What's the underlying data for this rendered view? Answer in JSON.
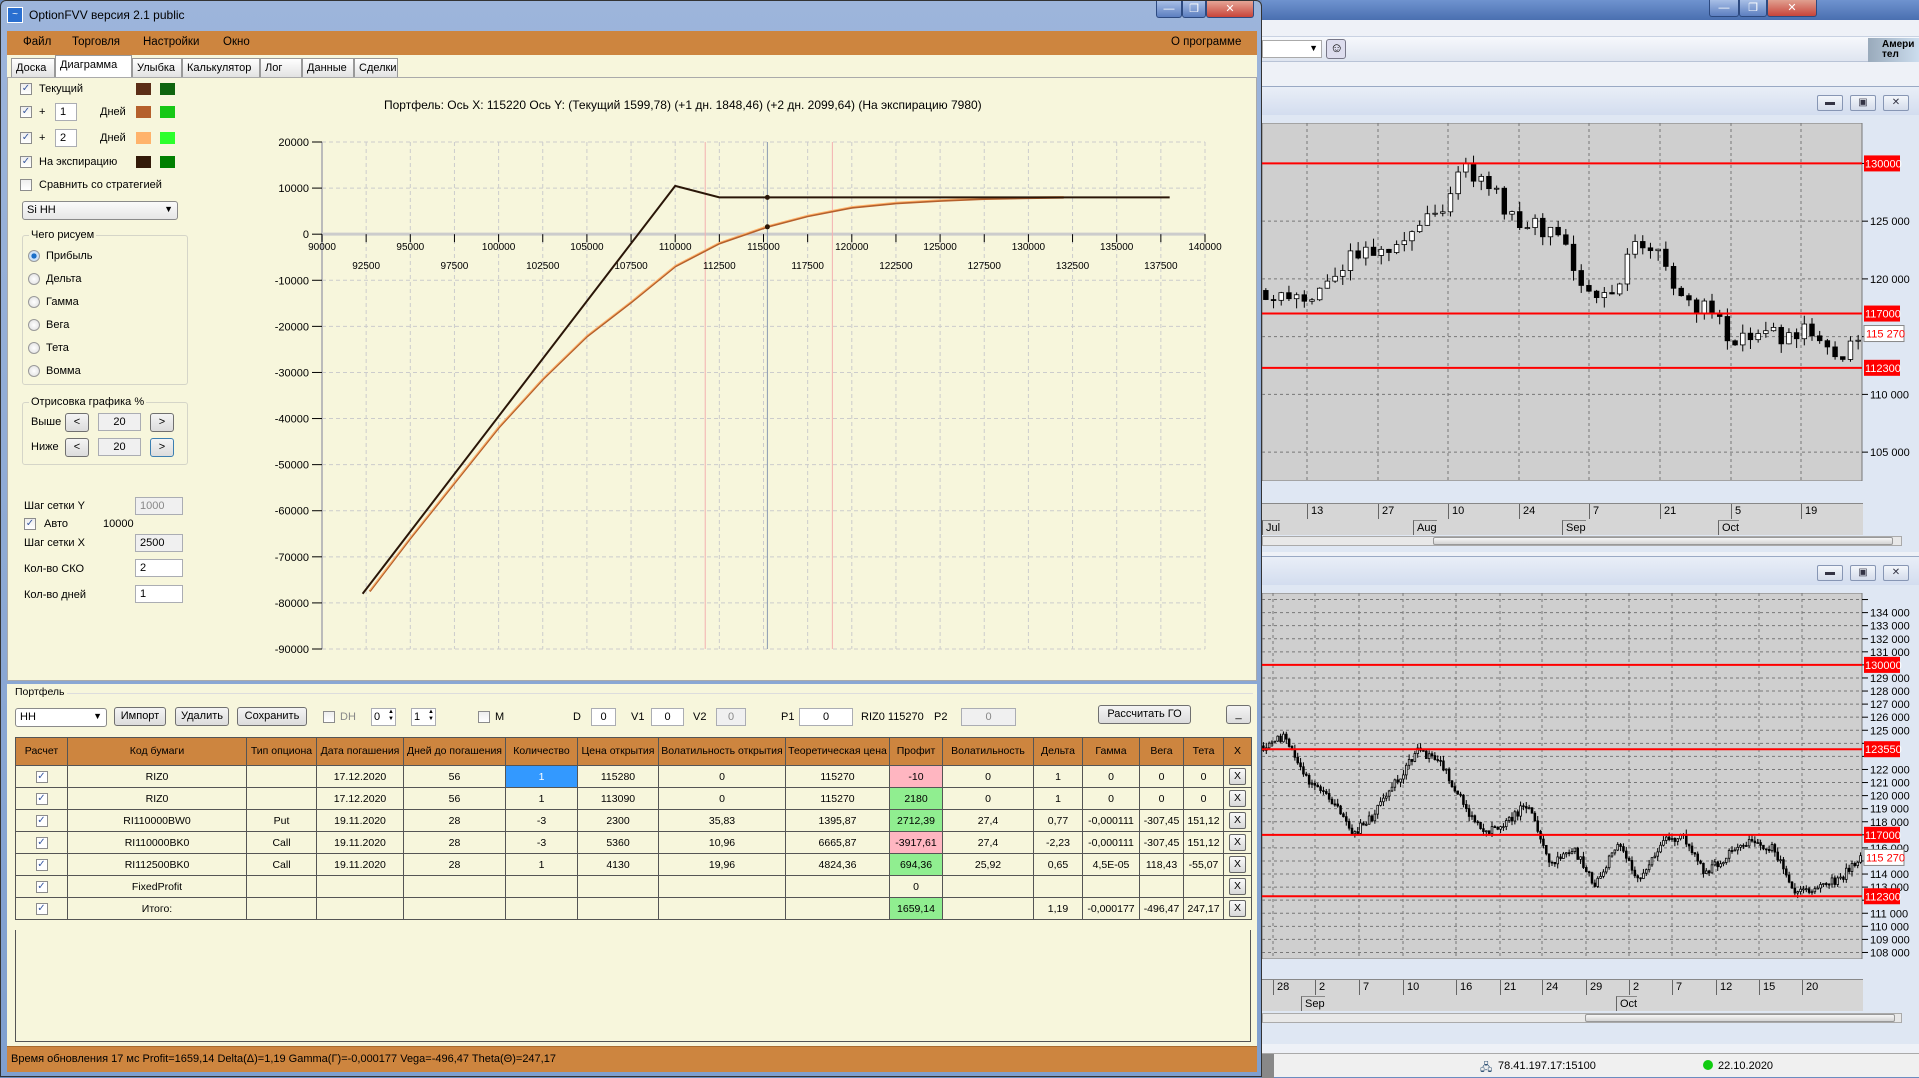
{
  "window": {
    "title": "OptionFVV версия 2.1 public",
    "min": "—",
    "max": "❐",
    "close": "✕"
  },
  "menu": {
    "items": [
      "Файл",
      "Торговля",
      "Настройки",
      "Окно"
    ],
    "about": "О программе"
  },
  "tabs": [
    "Доска",
    "Диаграмма",
    "Улыбка",
    "Калькулятор",
    "Лог",
    "Данные",
    "Сделки"
  ],
  "active_tab": "Диаграмма",
  "left_panel": {
    "curves": [
      {
        "label": "Текущий",
        "checked": true,
        "days": null,
        "colors": [
          "#5c2e17",
          "#0e640e"
        ]
      },
      {
        "label": "+",
        "checked": true,
        "days": "1",
        "suffix": "Дней",
        "colors": [
          "#b5602c",
          "#16c816"
        ]
      },
      {
        "label": "+",
        "checked": true,
        "days": "2",
        "suffix": "Дней",
        "colors": [
          "#ffb36b",
          "#2cff2c"
        ]
      },
      {
        "label": "На экспирацию",
        "checked": true,
        "days": null,
        "colors": [
          "#331a08",
          "#008000"
        ]
      }
    ],
    "compare": {
      "label": "Сравнить со стратегией",
      "checked": false
    },
    "strategy_select": "Si HH",
    "draw_group": {
      "title": "Чего рисуем",
      "options": [
        "Прибыль",
        "Дельта",
        "Гамма",
        "Вега",
        "Тета",
        "Вомма"
      ],
      "selected": "Прибыль"
    },
    "range_group": {
      "title": "Отрисовка графика %",
      "above_label": "Выше",
      "above": "20",
      "below_label": "Ниже",
      "below": "20",
      "dec": "<",
      "inc": ">"
    },
    "grid_y_label": "Шаг сетки Y",
    "grid_y": "1000",
    "auto_label": "Авто",
    "auto_checked": true,
    "auto_value": "10000",
    "grid_x_label": "Шаг сетки X",
    "grid_x": "2500",
    "sko_label": "Кол-во СКО",
    "sko": "2",
    "days_label": "Кол-во дней",
    "days": "1"
  },
  "diagram": {
    "title": "Портфель: Ось X: 115220 Ось Y:  (Текущий 1599,78)  (+1 дн. 1848,46)  (+2 дн. 2099,64)  (На экспирацию 7980)"
  },
  "portfolio": {
    "title": "Портфель",
    "select": "HH",
    "buttons": {
      "import": "Импорт",
      "delete": "Удалить",
      "save": "Сохранить",
      "calc_go": "Рассчитать ГО",
      "minimize": "_"
    },
    "dh_label": "DH",
    "dh_checked": false,
    "spin1": "0",
    "spin2": "1",
    "m_label": "M",
    "m_checked": false,
    "d_label": "D",
    "d": "0",
    "v1_label": "V1",
    "v1": "0",
    "v2_label": "V2",
    "v2": "0",
    "p1_label": "P1",
    "p1": "0",
    "riz_label": "RIZ0 115270",
    "p2_label": "P2",
    "p2": "0",
    "columns": [
      "Расчет",
      "Код бумаги",
      "Тип опциона",
      "Дата погашения",
      "Дней до погашения",
      "Количество",
      "Цена открытия",
      "Волатильность открытия",
      "Теоретическая цена",
      "Профит",
      "Волатильность",
      "Дельта",
      "Гамма",
      "Вега",
      "Тета",
      "X"
    ],
    "rows": [
      {
        "check": true,
        "code": "RIZ0",
        "type": "",
        "date": "17.12.2020",
        "days": "56",
        "qty": "1",
        "open": "115280",
        "open_vol": "0",
        "theo": "115270",
        "profit": "-10",
        "profit_sign": "neg",
        "vol": "0",
        "delta": "1",
        "gamma": "0",
        "vega": "0",
        "theta": "0",
        "x": "X",
        "selected_qty": true
      },
      {
        "check": true,
        "code": "RIZ0",
        "type": "",
        "date": "17.12.2020",
        "days": "56",
        "qty": "1",
        "open": "113090",
        "open_vol": "0",
        "theo": "115270",
        "profit": "2180",
        "profit_sign": "pos",
        "vol": "0",
        "delta": "1",
        "gamma": "0",
        "vega": "0",
        "theta": "0",
        "x": "X"
      },
      {
        "check": true,
        "code": "RI110000BW0",
        "type": "Put",
        "date": "19.11.2020",
        "days": "28",
        "qty": "-3",
        "open": "2300",
        "open_vol": "35,83",
        "theo": "1395,87",
        "profit": "2712,39",
        "profit_sign": "pos",
        "vol": "27,4",
        "delta": "0,77",
        "gamma": "-0,000111",
        "vega": "-307,45",
        "theta": "151,12",
        "x": "X"
      },
      {
        "check": true,
        "code": "RI110000BK0",
        "type": "Call",
        "date": "19.11.2020",
        "days": "28",
        "qty": "-3",
        "open": "5360",
        "open_vol": "10,96",
        "theo": "6665,87",
        "profit": "-3917,61",
        "profit_sign": "neg",
        "vol": "27,4",
        "delta": "-2,23",
        "gamma": "-0,000111",
        "vega": "-307,45",
        "theta": "151,12",
        "x": "X"
      },
      {
        "check": true,
        "code": "RI112500BK0",
        "type": "Call",
        "date": "19.11.2020",
        "days": "28",
        "qty": "1",
        "open": "4130",
        "open_vol": "19,96",
        "theo": "4824,36",
        "profit": "694,36",
        "profit_sign": "pos",
        "vol": "25,92",
        "delta": "0,65",
        "gamma": "4,5E-05",
        "vega": "118,43",
        "theta": "-55,07",
        "x": "X"
      },
      {
        "check": true,
        "code": "FixedProfit",
        "type": "",
        "date": "",
        "days": "",
        "qty": "",
        "open": "",
        "open_vol": "",
        "theo": "",
        "profit": "0",
        "profit_sign": "",
        "vol": "",
        "delta": "",
        "gamma": "",
        "vega": "",
        "theta": "",
        "x": "X"
      },
      {
        "check": true,
        "code": "Итого:",
        "type": "",
        "date": "",
        "days": "",
        "qty": "",
        "open": "",
        "open_vol": "",
        "theo": "",
        "profit": "1659,14",
        "profit_sign": "pos",
        "vol": "",
        "delta": "1,19",
        "gamma": "-0,000177",
        "vega": "-496,47",
        "theta": "247,17",
        "x": "X"
      }
    ]
  },
  "status": "Время обновления 17 мс  Profit=1659,14 Delta(Δ)=1,19 Gamma(Γ)=-0,000177 Vega=-496,47 Theta(Θ)=247,17",
  "background_app": {
    "toolbar_text": "Амери тел",
    "status_ip": "78.41.197.17:15100",
    "status_date": "22.10.2020"
  },
  "chart_data": [
    {
      "type": "line",
      "title": "Портфель: Ось X: 115220 Ось Y",
      "xlim": [
        90000,
        140000
      ],
      "ylim": [
        -90000,
        20000
      ],
      "x_ticks_major": [
        "90000",
        "95000",
        "100000",
        "105000",
        "110000",
        "115000",
        "120000",
        "125000",
        "130000",
        "135000",
        "140000"
      ],
      "x_ticks_minor": [
        "92500",
        "97500",
        "102500",
        "107500",
        "112500",
        "117500",
        "122500",
        "127500",
        "132500",
        "137500"
      ],
      "y_ticks": [
        "20000",
        "10000",
        "0",
        "-10000",
        "-20000",
        "-30000",
        "-40000",
        "-50000",
        "-60000",
        "-70000",
        "-80000",
        "-90000"
      ],
      "grid": true,
      "cursor_x": 115220,
      "sd_lines": [
        111700,
        118900
      ],
      "series": [
        {
          "name": "Текущий",
          "color": "#b5602c",
          "points": [
            [
              92700,
              -77500
            ],
            [
              95000,
              -66000
            ],
            [
              97500,
              -54000
            ],
            [
              100000,
              -42000
            ],
            [
              102500,
              -31500
            ],
            [
              105000,
              -22200
            ],
            [
              107500,
              -14800
            ],
            [
              110000,
              -7000
            ],
            [
              112500,
              -2000
            ],
            [
              115220,
              1600
            ],
            [
              117500,
              3900
            ],
            [
              120000,
              5750
            ],
            [
              122500,
              6700
            ],
            [
              125000,
              7250
            ],
            [
              127500,
              7650
            ],
            [
              130000,
              7850
            ],
            [
              132000,
              7950
            ]
          ]
        },
        {
          "name": "На экспирацию",
          "color": "#2a1608",
          "points": [
            [
              92300,
              -78020
            ],
            [
              110000,
              10480
            ],
            [
              112500,
              7980
            ],
            [
              138000,
              7980
            ]
          ]
        }
      ],
      "markers": [
        {
          "x": 115220,
          "y": 1600
        },
        {
          "x": 115220,
          "y": 7980
        }
      ]
    },
    {
      "type": "candlestick",
      "ylim": [
        102500,
        133500
      ],
      "y_ticks": [
        "125 000",
        "120 000",
        "110 000",
        "105 000"
      ],
      "y_tick_values": [
        125000,
        120000,
        110000,
        105000
      ],
      "levels": [
        {
          "value": 130000,
          "label": "130000"
        },
        {
          "value": 117000,
          "label": "117000"
        },
        {
          "value": 112300,
          "label": "112300"
        }
      ],
      "last": {
        "value": 115270,
        "label": "115 270"
      },
      "candles": 78,
      "path": [
        119000,
        118500,
        118000,
        121000,
        122500,
        121500,
        124000,
        126000,
        129500,
        128500,
        125000,
        124500,
        123500,
        119000,
        118000,
        123500,
        122000,
        118000,
        117500,
        114500,
        115500,
        114800,
        115500,
        112800,
        115300
      ],
      "day_labels": [
        "13",
        "27",
        "10",
        "24",
        "7",
        "21",
        "5",
        "19"
      ],
      "month_labels": [
        "Jul",
        "Aug",
        "Sep",
        "Oct"
      ]
    },
    {
      "type": "candlestick",
      "ylim": [
        107500,
        135500
      ],
      "y_ticks": [
        "134 000",
        "133 000",
        "132 000",
        "131 000",
        "129 000",
        "128 000",
        "127 000",
        "126 000",
        "125 000",
        "122 000",
        "121 000",
        "120 000",
        "119 000",
        "118 000",
        "116 000",
        "114 000",
        "113 000",
        "111 000",
        "110 000",
        "109 000",
        "108 000"
      ],
      "y_tick_values": [
        134000,
        133000,
        132000,
        131000,
        129000,
        128000,
        127000,
        126000,
        125000,
        122000,
        121000,
        120000,
        119000,
        118000,
        116000,
        114000,
        113000,
        111000,
        110000,
        109000,
        108000
      ],
      "levels": [
        {
          "value": 130000,
          "label": "130000"
        },
        {
          "value": 123550,
          "label": "123550"
        },
        {
          "value": 117000,
          "label": "117000"
        },
        {
          "value": 112300,
          "label": "112300"
        }
      ],
      "last": {
        "value": 115270,
        "label": "115 270"
      },
      "candles": 210,
      "path": [
        123800,
        124500,
        121000,
        120000,
        117000,
        118500,
        121000,
        123500,
        122500,
        119500,
        117000,
        118000,
        119500,
        114500,
        116000,
        113000,
        116500,
        113500,
        116500,
        117000,
        114000,
        115500,
        116500,
        116000,
        112800,
        113000,
        113500,
        115300
      ],
      "day_labels": [
        "28",
        "2",
        "7",
        "10",
        "16",
        "21",
        "24",
        "29",
        "2",
        "7",
        "12",
        "15",
        "20"
      ],
      "month_labels": [
        "Sep",
        "Oct"
      ]
    }
  ]
}
